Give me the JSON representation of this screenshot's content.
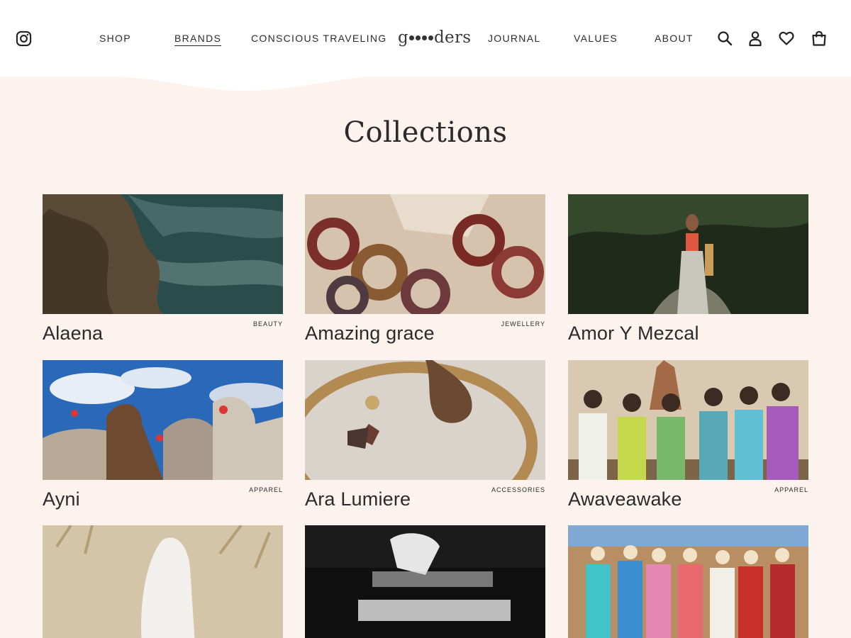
{
  "header": {
    "nav_left": [
      "SHOP",
      "BRANDS",
      "CONSCIOUS TRAVELING"
    ],
    "nav_right": [
      "JOURNAL",
      "VALUES",
      "ABOUT"
    ],
    "logo": {
      "prefix": "g",
      "suffix": "ders"
    },
    "icons": [
      "instagram-icon",
      "search-icon",
      "account-icon",
      "heart-icon",
      "bag-icon"
    ]
  },
  "page": {
    "title": "Collections"
  },
  "collections": [
    {
      "name": "Alaena",
      "category": "BEAUTY"
    },
    {
      "name": "Amazing grace",
      "category": "JEWELLERY"
    },
    {
      "name": "Amor Y Mezcal",
      "category": ""
    },
    {
      "name": "Ayni",
      "category": "APPAREL"
    },
    {
      "name": "Ara Lumiere",
      "category": "ACCESSORIES"
    },
    {
      "name": "Awaveawake",
      "category": "APPAREL"
    },
    {
      "name": "",
      "category": ""
    },
    {
      "name": "",
      "category": ""
    },
    {
      "name": "",
      "category": ""
    }
  ],
  "colors": {
    "background": "#fcf3ee",
    "header": "#ffffff",
    "text": "#2b2b2b"
  }
}
